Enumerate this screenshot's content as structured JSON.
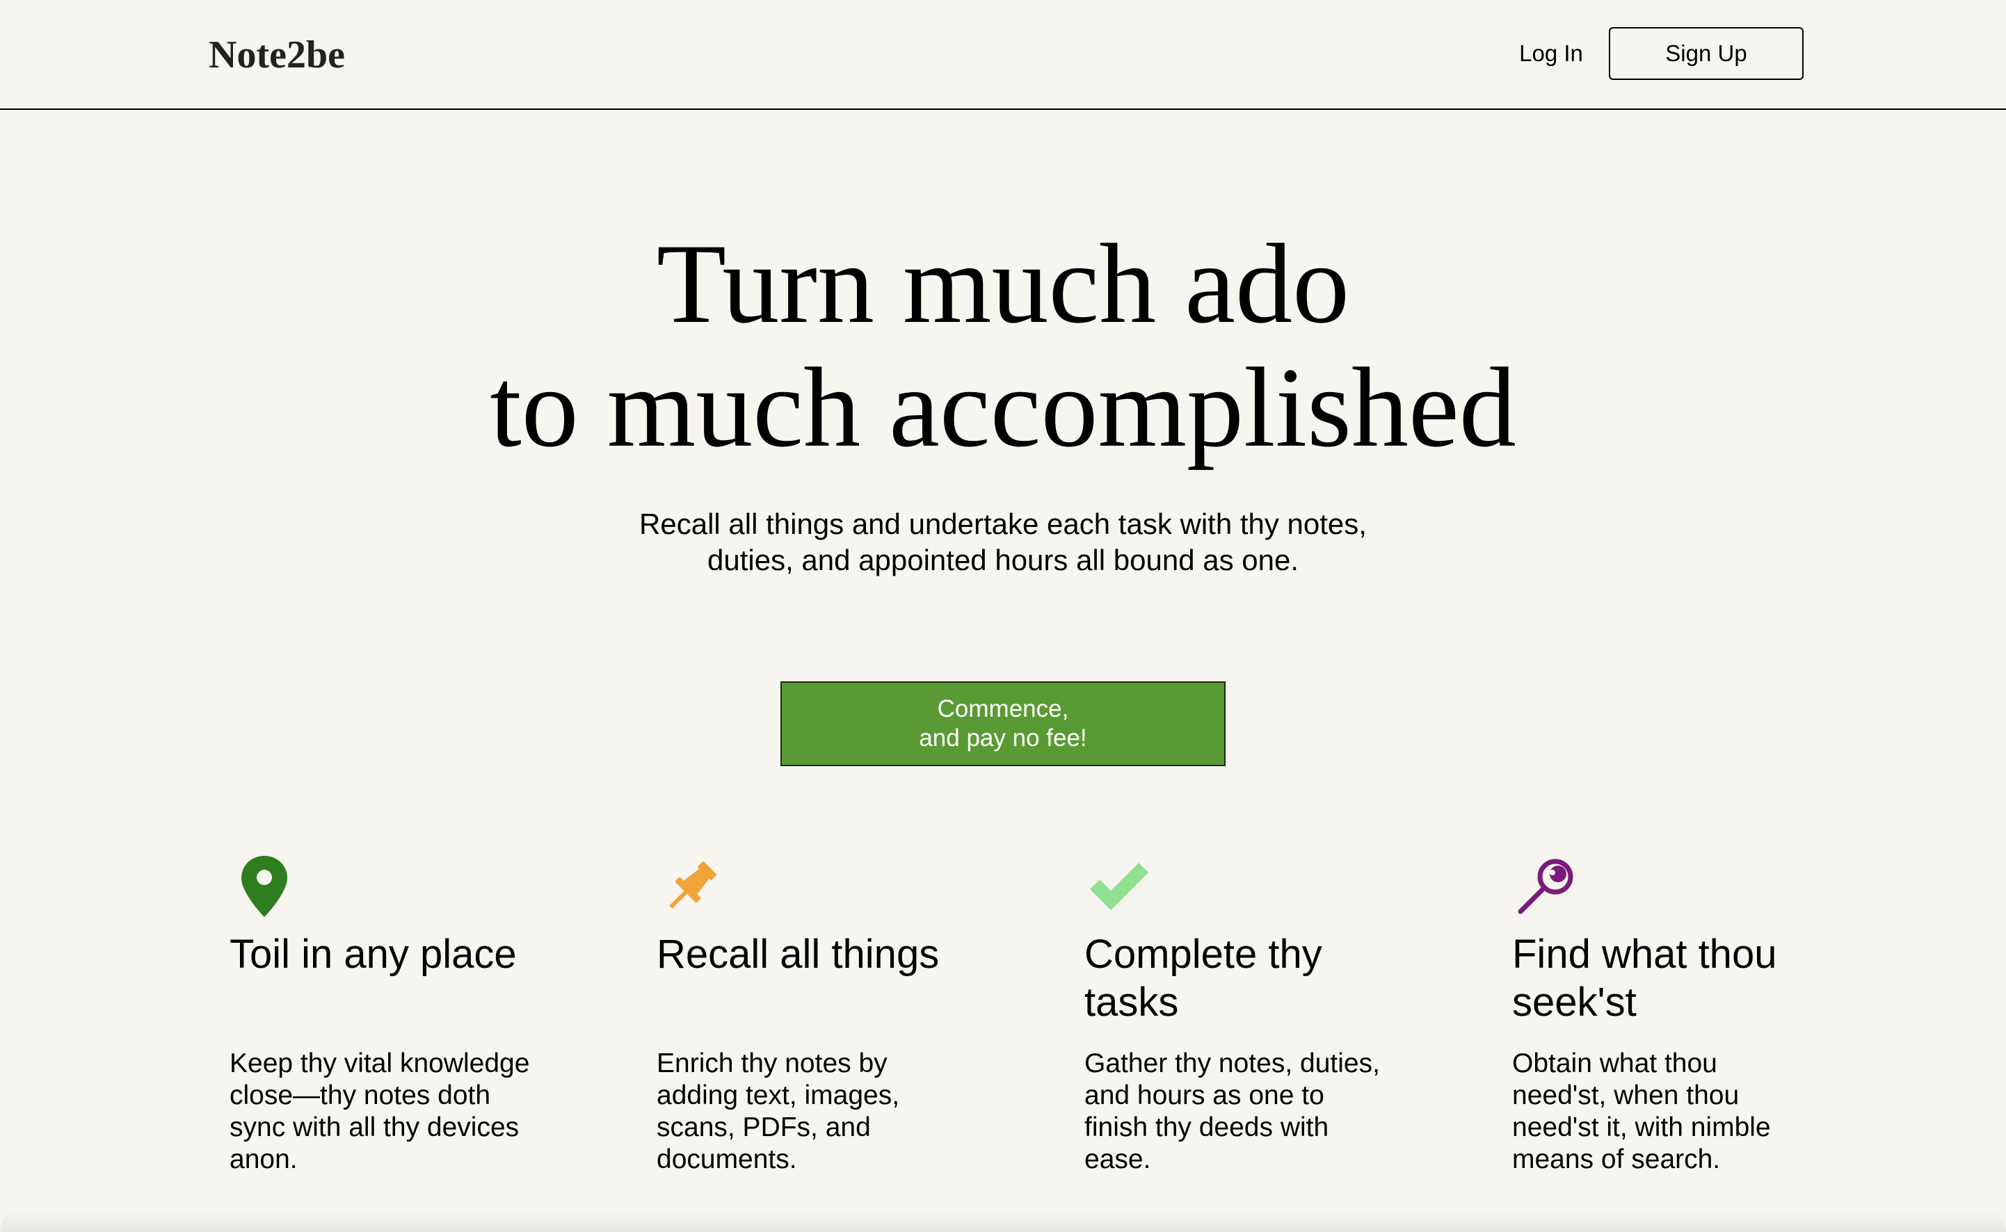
{
  "header": {
    "logo": "Note2be",
    "login_label": "Log In",
    "signup_label": "Sign Up"
  },
  "hero": {
    "title_line1": "Turn much ado",
    "title_line2": "to much accomplished",
    "subtitle_line1": "Recall all things and undertake each task with thy notes,",
    "subtitle_line2": "duties, and appointed hours all bound as one.",
    "cta_line1": "Commence,",
    "cta_line2": "and pay no fee!"
  },
  "features": [
    {
      "icon": "location-pin-icon",
      "color": "#2e7d1f",
      "title": "Toil in any place",
      "text": "Keep thy vital knowledge close—thy notes doth sync with all thy devices anon."
    },
    {
      "icon": "pushpin-icon",
      "color": "#f0a43a",
      "title": "Recall all things",
      "text": "Enrich thy notes by adding text, images, scans, PDFs, and documents."
    },
    {
      "icon": "checkmark-icon",
      "color": "#90e090",
      "title": "Complete thy tasks",
      "text": "Gather thy notes, duties, and hours as one to finish thy deeds with ease."
    },
    {
      "icon": "magnifier-icon",
      "color": "#7a1a7a",
      "title": "Find what thou seek'st",
      "text": "Obtain what thou need'st, when thou need'st it, with nimble means of search."
    }
  ],
  "colors": {
    "background": "#f7f5ef",
    "cta_green": "#5a9a34"
  }
}
